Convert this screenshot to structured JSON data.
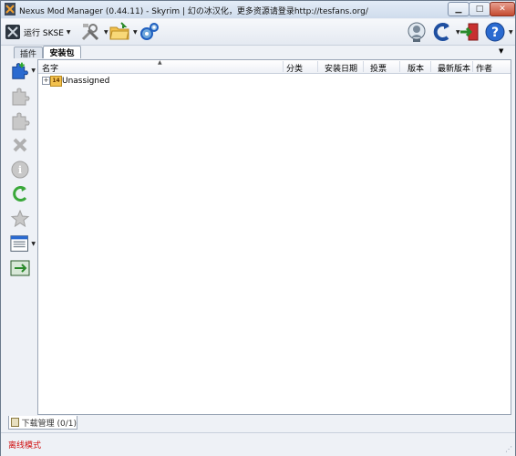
{
  "window": {
    "title": "Nexus Mod Manager (0.44.11) - Skyrim | 幻の冰汉化，更多资源请登录http://tesfans.org/",
    "min_glyph": "▁",
    "max_glyph": "□",
    "close_glyph": "✕"
  },
  "toolbar": {
    "launch_label": "运行 SKSE",
    "icons": [
      "game-icon",
      "tools-icon",
      "folder-icon",
      "settings-icon",
      "profile-icon",
      "refresh-icon",
      "logout-icon",
      "help-icon"
    ]
  },
  "tabs": {
    "plugins": "插件",
    "mods": "安装包",
    "menu_glyph": "▼"
  },
  "columns": [
    "名字",
    "分类",
    "安装日期",
    "投票",
    "版本",
    "最新版本",
    "作者"
  ],
  "tree": {
    "expander": "+",
    "category_icon_text": "14",
    "category_label": "Unassigned"
  },
  "sidebar": {
    "icons": [
      "add-mod-icon",
      "activate-mod-icon",
      "deactivate-mod-icon",
      "delete-mod-icon",
      "mod-info-icon",
      "check-updates-icon",
      "endorse-icon",
      "categories-icon",
      "export-icon"
    ]
  },
  "downloads": {
    "label": "下载管理 (0/1)"
  },
  "status": {
    "text": "离线模式",
    "grip": "⋰"
  },
  "colors": {
    "accent": "#1f5fbf",
    "status_red": "#d01010"
  }
}
